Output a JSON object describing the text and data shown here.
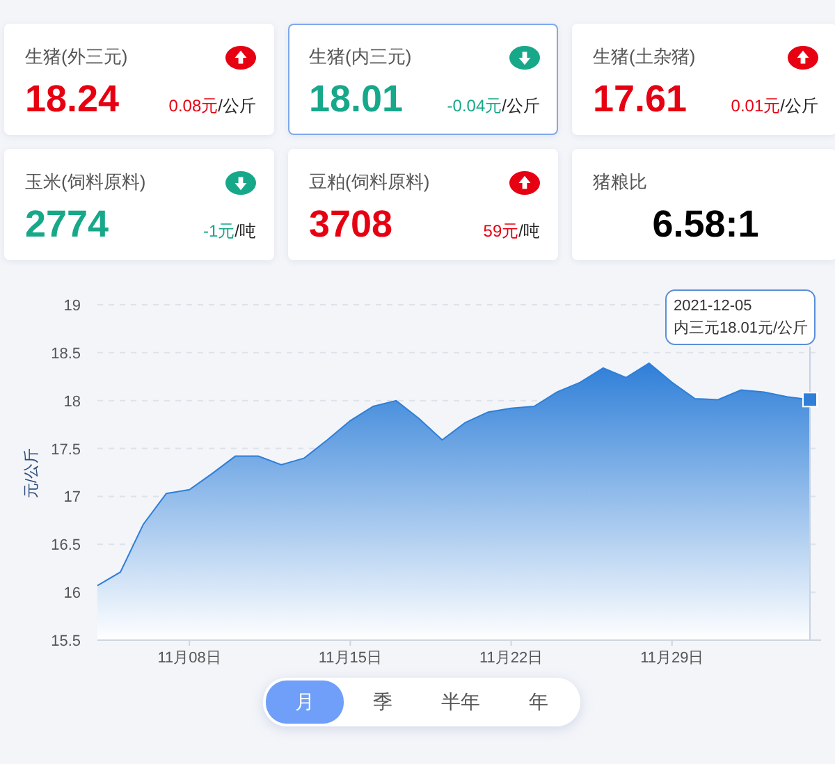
{
  "cards": [
    {
      "kind": "price",
      "title": "生猪(外三元)",
      "rising": true,
      "value": "18.24",
      "change": "0.08元",
      "unit": "/公斤",
      "selected": false
    },
    {
      "kind": "price",
      "title": "生猪(内三元)",
      "rising": false,
      "value": "18.01",
      "change": "-0.04元",
      "unit": "/公斤",
      "selected": true
    },
    {
      "kind": "price",
      "title": "生猪(土杂猪)",
      "rising": true,
      "value": "17.61",
      "change": "0.01元",
      "unit": "/公斤",
      "selected": false
    },
    {
      "kind": "price",
      "title": "玉米(饲料原料)",
      "rising": false,
      "value": "2774",
      "change": "-1元",
      "unit": "/吨",
      "selected": false
    },
    {
      "kind": "price",
      "title": "豆粕(饲料原料)",
      "rising": true,
      "value": "3708",
      "change": "59元",
      "unit": "/吨",
      "selected": false
    },
    {
      "kind": "ratio",
      "title": "猪粮比",
      "value": "6.58:1",
      "selected": false
    }
  ],
  "chart": {
    "tooltip": {
      "date": "2021-12-05",
      "text": "内三元18.01元/公斤"
    },
    "chart_data": {
      "type": "area",
      "ylabel": "元/公斤",
      "ylim": [
        15.5,
        19
      ],
      "yticks": [
        15.5,
        16,
        16.5,
        17,
        17.5,
        18,
        18.5,
        19
      ],
      "grid": true,
      "categories": [
        null,
        null,
        null,
        null,
        "11月08日",
        null,
        null,
        null,
        null,
        null,
        null,
        "11月15日",
        null,
        null,
        null,
        null,
        null,
        null,
        "11月22日",
        null,
        null,
        null,
        null,
        null,
        null,
        "11月29日",
        null,
        null,
        null,
        null,
        null,
        null
      ],
      "series": [
        {
          "color": "#2f7fd8",
          "values": [
            16.07,
            16.21,
            16.71,
            17.03,
            17.07,
            17.24,
            17.42,
            17.42,
            17.33,
            17.4,
            17.59,
            17.79,
            17.94,
            18.0,
            17.81,
            17.59,
            17.77,
            17.88,
            17.92,
            17.94,
            18.09,
            18.19,
            18.34,
            18.24,
            18.39,
            18.19,
            18.02,
            18.01,
            18.11,
            18.09,
            18.04,
            18.01
          ]
        }
      ]
    }
  },
  "periods": [
    {
      "label": "月",
      "selected": true
    },
    {
      "label": "季",
      "selected": false
    },
    {
      "label": "半年",
      "selected": false
    },
    {
      "label": "年",
      "selected": false
    }
  ]
}
